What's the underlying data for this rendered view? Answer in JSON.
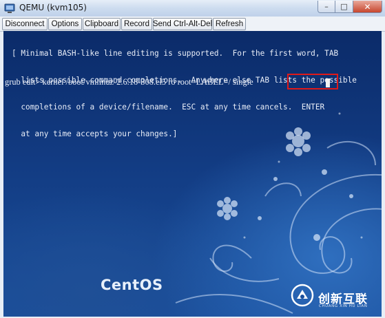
{
  "window": {
    "title": "QEMU (kvm105)",
    "minimize": "–",
    "maximize": "□",
    "close": "✕"
  },
  "toolbar": {
    "buttons": [
      "Disconnect",
      "Options",
      "Clipboard",
      "Record",
      "Send Ctrl-Alt-Del",
      "Refresh"
    ]
  },
  "console": {
    "help_lines": [
      "[ Minimal BASH-like line editing is supported.  For the first word, TAB",
      "  lists possible command completions.  Anywhere else TAB lists the possible",
      "  completions of a device/filename.  ESC at any time cancels.  ENTER",
      "  at any time accepts your changes.]"
    ],
    "command_line": "grub edit> kernel /boot/vmlinuz-2.6.18-308.el5 ro root=LABEL=/ single",
    "brand": "CentOS"
  },
  "watermark": {
    "name": "创新互联",
    "subtitle": "CHUANG XIN HU LIAN"
  },
  "colors": {
    "highlight": "#e01919",
    "console_bg": "#123b82"
  }
}
